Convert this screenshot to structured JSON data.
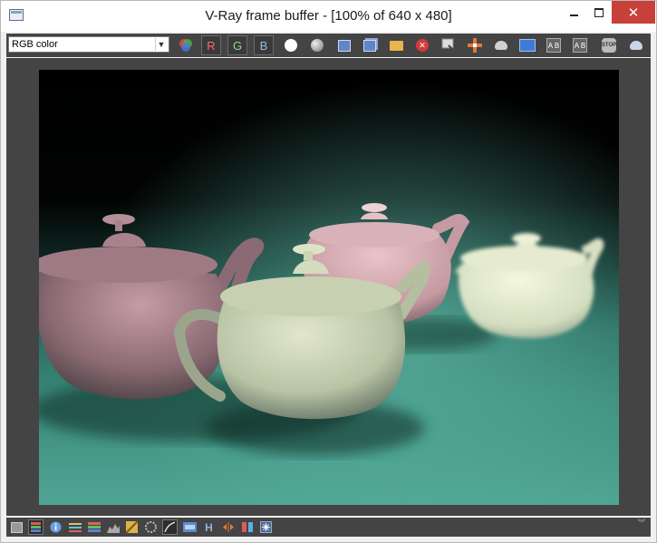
{
  "window": {
    "title": "V-Ray frame buffer - [100% of 640 x 480]",
    "minimize_glyph": "",
    "close_glyph": "✕"
  },
  "toolbar": {
    "channel_value": "RGB color",
    "r_label": "R",
    "g_label": "G",
    "b_label": "B",
    "clear_glyph": "✕",
    "compare_a_label": "A B",
    "compare_b_label": "A B",
    "stop_label": "STOP",
    "icons": [
      "rgb-color-icon",
      "red-channel",
      "green-channel",
      "blue-channel",
      "monochrome-icon",
      "alpha-icon",
      "save-icon",
      "save-all-icon",
      "load-icon",
      "clear-icon",
      "copy-to-max-icon",
      "track-mouse-icon",
      "render-teapot-icon",
      "history-icon",
      "compare-a-icon",
      "compare-b-icon",
      "stop-icon",
      "render-icon"
    ]
  },
  "statusbar": {
    "h_label": "H",
    "icons": [
      "frame-icon",
      "color-corrections-icon",
      "info-icon",
      "levels-icon",
      "curves-icon",
      "exposure-icon",
      "lut-icon",
      "hsv-icon",
      "lens-effects-icon",
      "srgb-icon",
      "ocio-icon",
      "h-icon",
      "split-icon",
      "history-icon",
      "settings-icon"
    ],
    "expand_glyph": "︾"
  },
  "colors": {
    "panel": "#444444",
    "close_red": "#c7403a",
    "floor_teal": "#3d8f80"
  }
}
